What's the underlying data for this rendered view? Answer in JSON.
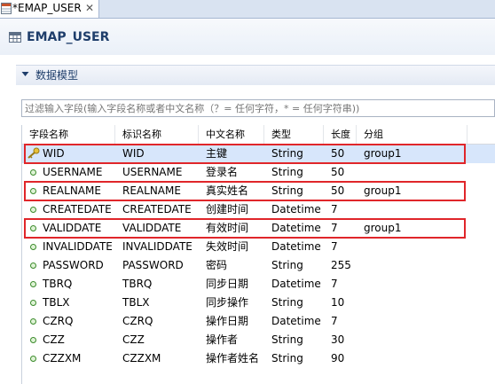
{
  "tab": {
    "label": "*EMAP_USER",
    "close": "✕"
  },
  "header": {
    "title": "EMAP_USER"
  },
  "section": {
    "title": "数据模型"
  },
  "filter": {
    "placeholder": "过滤输入字段(输入字段名称或者中文名称（？= 任何字符，* = 任何字符串))"
  },
  "table": {
    "columns": [
      "字段名称",
      "标识名称",
      "中文名称",
      "类型",
      "长度",
      "分组"
    ],
    "rows": [
      [
        "WID",
        "WID",
        "主键",
        "String",
        "50",
        "group1"
      ],
      [
        "USERNAME",
        "USERNAME",
        "登录名",
        "String",
        "50",
        ""
      ],
      [
        "REALNAME",
        "REALNAME",
        "真实姓名",
        "String",
        "50",
        "group1"
      ],
      [
        "CREATEDATE",
        "CREATEDATE",
        "创建时间",
        "Datetime",
        "7",
        ""
      ],
      [
        "VALIDDATE",
        "VALIDDATE",
        "有效时间",
        "Datetime",
        "7",
        "group1"
      ],
      [
        "INVALIDDATE",
        "INVALIDDATE",
        "失效时间",
        "Datetime",
        "7",
        ""
      ],
      [
        "PASSWORD",
        "PASSWORD",
        "密码",
        "String",
        "255",
        ""
      ],
      [
        "TBRQ",
        "TBRQ",
        "同步日期",
        "Datetime",
        "7",
        ""
      ],
      [
        "TBLX",
        "TBLX",
        "同步操作",
        "String",
        "10",
        ""
      ],
      [
        "CZRQ",
        "CZRQ",
        "操作日期",
        "Datetime",
        "7",
        ""
      ],
      [
        "CZZ",
        "CZZ",
        "操作者",
        "String",
        "30",
        ""
      ],
      [
        "CZZXM",
        "CZZXM",
        "操作者姓名",
        "String",
        "90",
        ""
      ]
    ],
    "selected_row": 0,
    "highlighted_rows": [
      0,
      2,
      4
    ]
  },
  "colors": {
    "highlight": "#e0262a",
    "selection": "#d7e6fb",
    "title": "#1f3e6b"
  },
  "icons": {
    "tab": "table-editor-icon",
    "header": "table-icon",
    "section": "chevron-down-icon",
    "primary_key": "key-icon",
    "field": "field-dot-icon",
    "close": "close-icon"
  }
}
